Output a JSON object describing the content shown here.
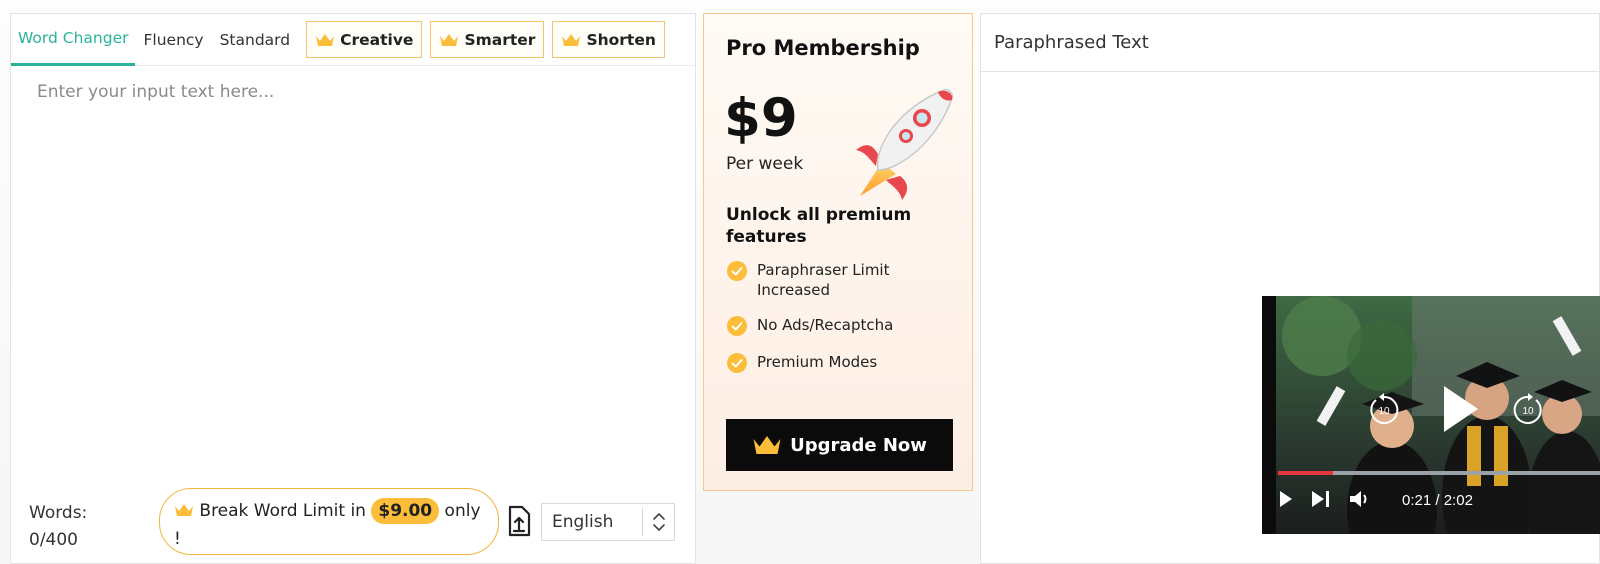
{
  "editor": {
    "tabs": [
      {
        "label": "Word Changer",
        "active": true
      },
      {
        "label": "Fluency"
      },
      {
        "label": "Standard"
      }
    ],
    "premium_tabs": [
      {
        "label": "Creative"
      },
      {
        "label": "Smarter"
      },
      {
        "label": "Shorten"
      }
    ],
    "input_placeholder": "Enter your input text here...",
    "words_label": "Words:",
    "words_count": "0/400",
    "break_limit": {
      "prefix": "Break Word Limit in",
      "price": "$9.00",
      "suffix": "only",
      "trail": "!"
    },
    "language": "English"
  },
  "pro": {
    "title": "Pro Membership",
    "price": "$9",
    "period": "Per week",
    "unlock": "Unlock all premium features",
    "features": [
      {
        "label": "Paraphraser Limit Increased"
      },
      {
        "label": "No Ads/Recaptcha"
      },
      {
        "label": "Premium Modes"
      }
    ],
    "upgrade_label": "Upgrade Now"
  },
  "output": {
    "title": "Paraphrased Text"
  },
  "video": {
    "current_time": "0:21",
    "separator": "/",
    "duration": "2:02",
    "progress": 0.17,
    "rewind_seconds": "10",
    "forward_seconds": "10"
  },
  "colors": {
    "accent": "#2bb39a",
    "gold": "#fbbd3a",
    "border_gold": "#f5c36d",
    "progress_red": "#e9353e"
  }
}
